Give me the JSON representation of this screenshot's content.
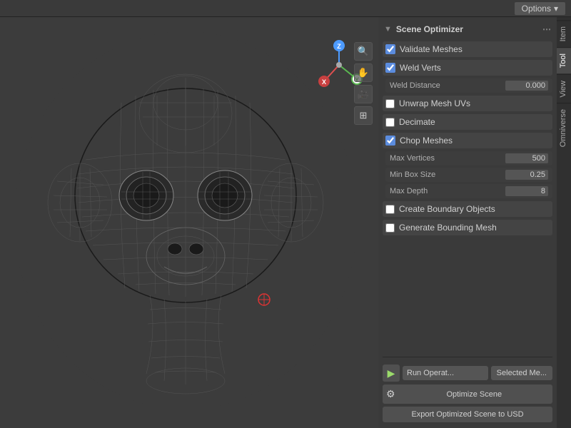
{
  "topbar": {
    "options_label": "Options",
    "chevron": "▾"
  },
  "viewport": {
    "gizmo": {
      "z_label": "Z",
      "x_label": "X",
      "y_label": "Y"
    },
    "controls": [
      "🔍",
      "✋",
      "🎥",
      "⊞"
    ]
  },
  "tabs": [
    {
      "id": "item",
      "label": "Item"
    },
    {
      "id": "tool",
      "label": "Tool",
      "active": true
    },
    {
      "id": "view",
      "label": "View"
    },
    {
      "id": "omniverse",
      "label": "Omniverse"
    }
  ],
  "panel": {
    "section_icon": "▼",
    "section_title": "Scene Optimizer",
    "three_dot": "⋯",
    "validate_meshes": {
      "label": "Validate Meshes",
      "checked": true
    },
    "weld_verts": {
      "label": "Weld Verts",
      "checked": true,
      "sub": {
        "weld_distance_label": "Weld Distance",
        "weld_distance_val": "0.000"
      }
    },
    "unwrap_uvs": {
      "label": "Unwrap Mesh UVs",
      "checked": false
    },
    "decimate": {
      "label": "Decimate",
      "checked": false
    },
    "chop_meshes": {
      "label": "Chop Meshes",
      "checked": true,
      "sub": {
        "max_vertices_label": "Max Vertices",
        "max_vertices_val": "500",
        "min_box_size_label": "Min Box Size",
        "min_box_size_val": "0.25",
        "max_depth_label": "Max Depth",
        "max_depth_val": "8"
      }
    },
    "create_boundary": {
      "label": "Create Boundary Objects",
      "checked": false
    },
    "generate_bounding": {
      "label": "Generate Bounding Mesh",
      "checked": false
    }
  },
  "bottom": {
    "run_label": "Run Operat...",
    "selected_label": "Selected Me...",
    "optimize_label": "Optimize Scene",
    "export_label": "Export Optimized Scene to USD"
  }
}
